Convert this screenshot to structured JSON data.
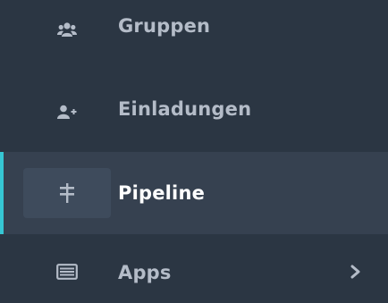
{
  "sidebar": {
    "items": [
      {
        "label": "Gruppen",
        "icon": "users-icon",
        "active": false
      },
      {
        "label": "Einladungen",
        "icon": "user-plus-icon",
        "active": false
      },
      {
        "label": "Pipeline",
        "icon": "pipeline-icon",
        "active": true
      },
      {
        "label": "Apps",
        "icon": "apps-icon",
        "active": false,
        "has_submenu": true
      }
    ]
  },
  "colors": {
    "background": "#2b3643",
    "active_background": "#364150",
    "accent": "#36c6d3",
    "text": "#b4bcc8",
    "active_text": "#ffffff"
  }
}
